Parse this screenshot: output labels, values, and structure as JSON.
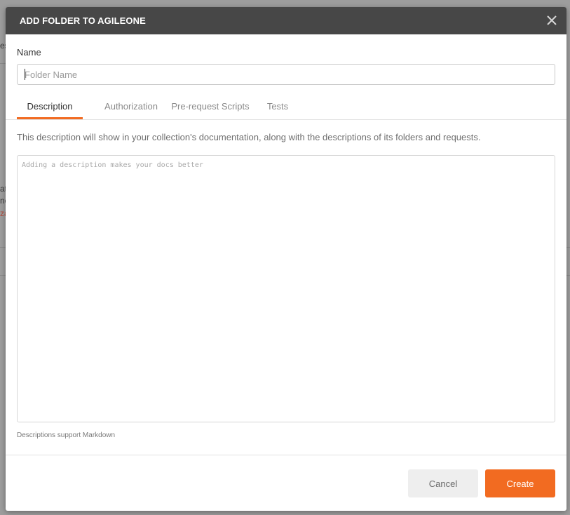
{
  "modal": {
    "title": "ADD FOLDER TO AGILEONE",
    "close_icon": "close-icon",
    "accent_color": "#f26b21",
    "header_color": "#474747"
  },
  "name_field": {
    "label": "Name",
    "placeholder": "Folder Name",
    "value": ""
  },
  "tabs": [
    {
      "label": "Description",
      "active": true
    },
    {
      "label": "Authorization",
      "active": false
    },
    {
      "label": "Pre-request Scripts",
      "active": false
    },
    {
      "label": "Tests",
      "active": false
    }
  ],
  "description": {
    "help_text": "This description will show in your collection's documentation, along with the descriptions of its folders and requests.",
    "placeholder": "Adding a description makes your docs better",
    "value": "",
    "markdown_note": "Descriptions support Markdown"
  },
  "footer": {
    "cancel_label": "Cancel",
    "create_label": "Create"
  },
  "background_fragments": [
    "es",
    "at",
    "ne",
    "za"
  ]
}
